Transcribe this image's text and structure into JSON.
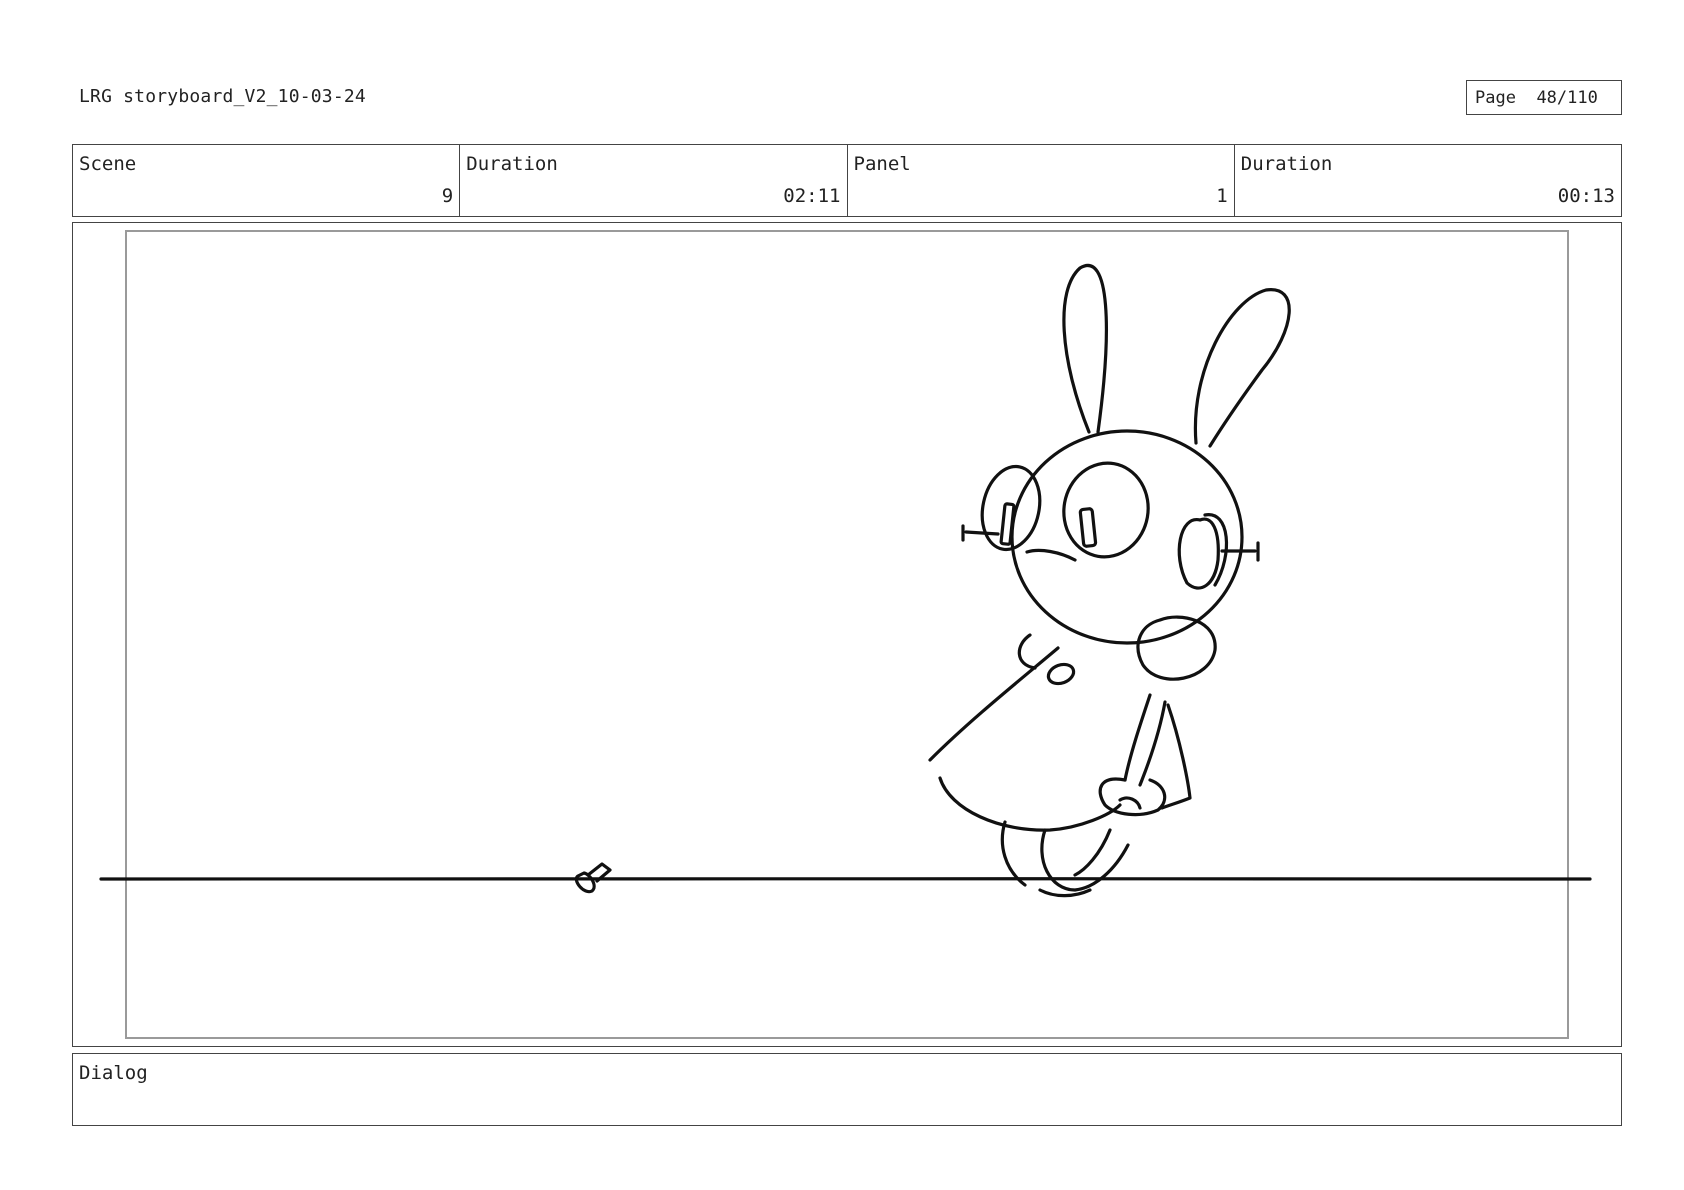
{
  "header": {
    "document_title": "LRG storyboard_V2_10-03-24",
    "page_label": "Page",
    "page_number": "48/110"
  },
  "info": [
    {
      "label": "Scene",
      "value": "9"
    },
    {
      "label": "Duration",
      "value": "02:11"
    },
    {
      "label": "Panel",
      "value": "1"
    },
    {
      "label": "Duration",
      "value": "00:13"
    }
  ],
  "panel": {
    "sketch_icon": "bunny-robot-sketch"
  },
  "dialog": {
    "label": "Dialog",
    "text": ""
  },
  "colors": {
    "border": "#444444",
    "safe_frame": "#9a9a9a",
    "ink": "#111111"
  }
}
